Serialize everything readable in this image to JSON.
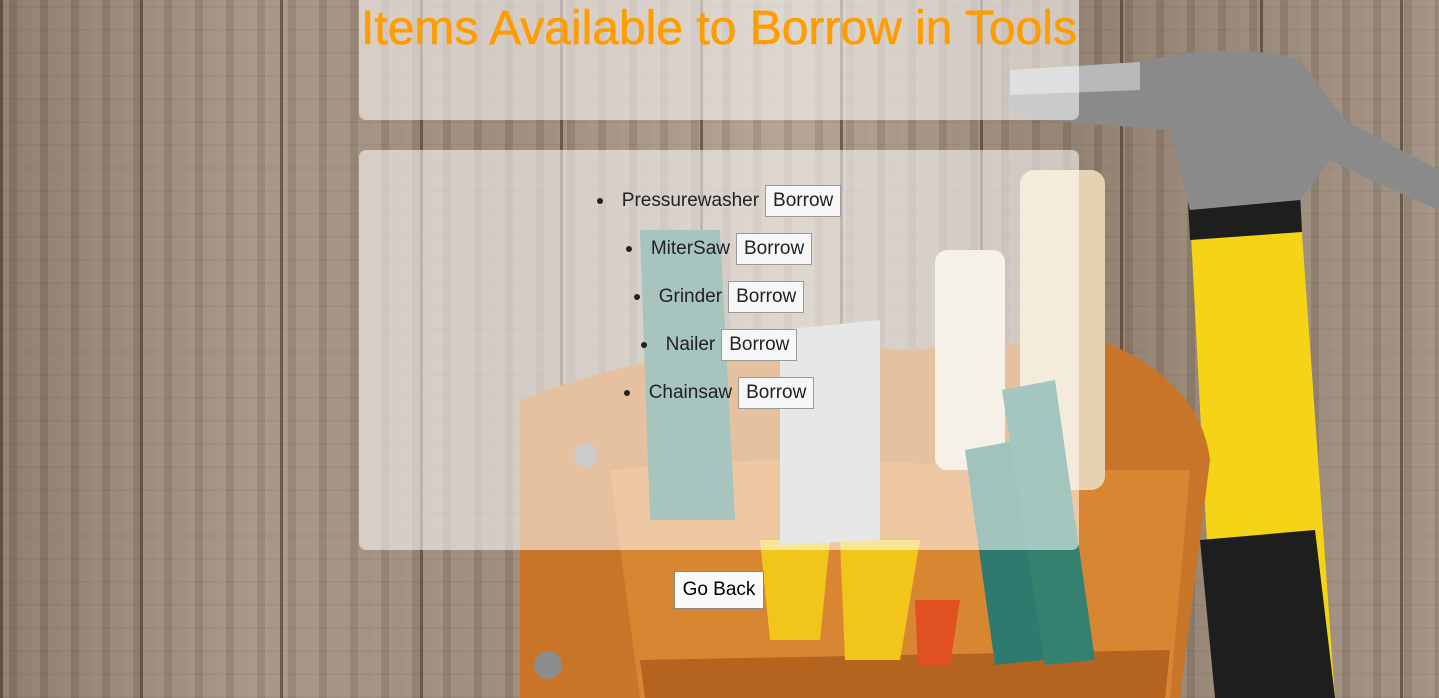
{
  "page": {
    "title": "Items Available to Borrow in Tools"
  },
  "items": [
    {
      "name": "Pressurewasher",
      "action": "Borrow"
    },
    {
      "name": "MiterSaw",
      "action": "Borrow"
    },
    {
      "name": "Grinder",
      "action": "Borrow"
    },
    {
      "name": "Nailer",
      "action": "Borrow"
    },
    {
      "name": "Chainsaw",
      "action": "Borrow"
    }
  ],
  "footer": {
    "back_label": "Go Back"
  },
  "colors": {
    "title": "#ff9d00",
    "panel": "#ffffff",
    "hammer_handle": "#f6d21a",
    "tool_belt": "#d9822b"
  }
}
